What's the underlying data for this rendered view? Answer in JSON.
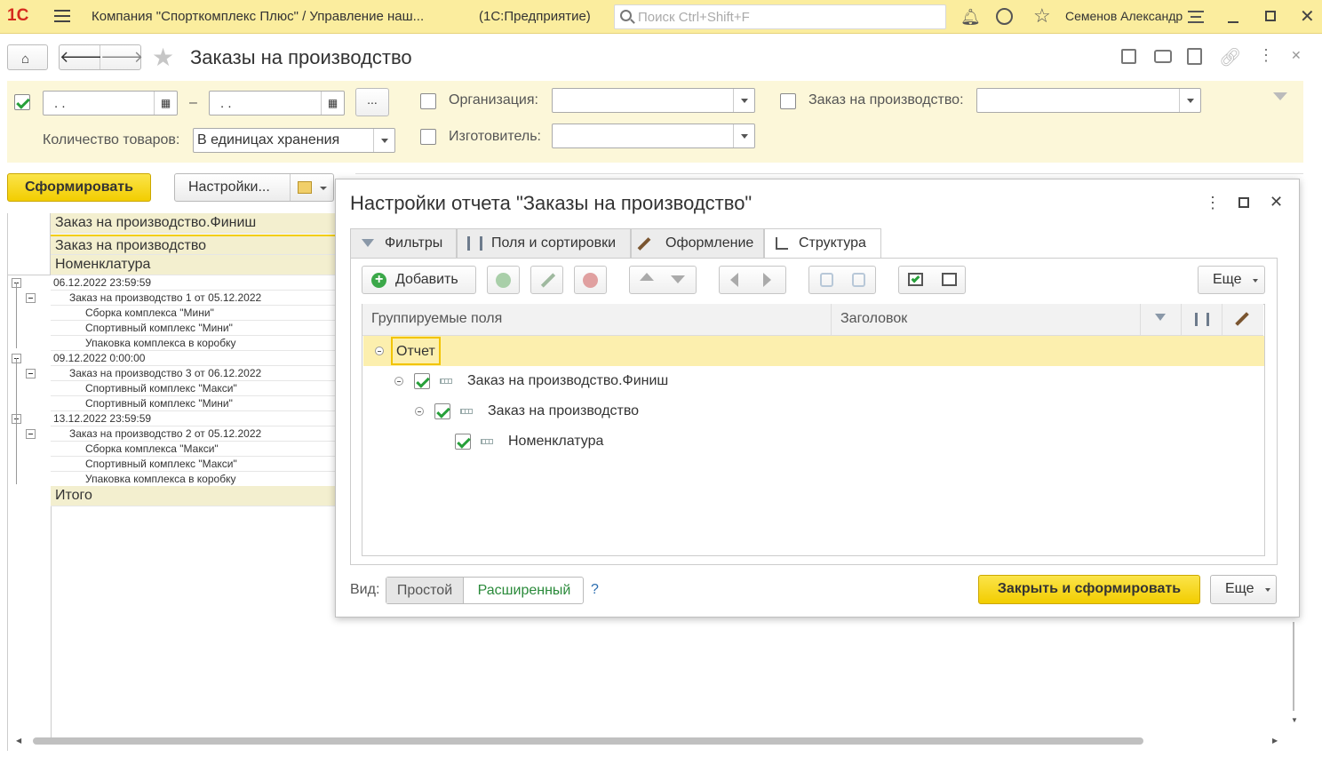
{
  "app": {
    "logo": "1С",
    "title": "Компания \"Спорткомплекс Плюс\" / Управление наш...",
    "platform": "(1С:Предприятие)",
    "search_placeholder": "Поиск Ctrl+Shift+F",
    "user": "Семенов Александр"
  },
  "page": {
    "title": "Заказы на производство"
  },
  "filters": {
    "date_from": " .  .",
    "date_to": " .  .",
    "dash": "–",
    "more": "...",
    "org_label": "Организация:",
    "order_label": "Заказ на производство:",
    "qty_label": "Количество товаров:",
    "qty_value": "В единицах хранения",
    "maker_label": "Изготовитель:"
  },
  "toolbar": {
    "generate": "Сформировать",
    "settings": "Настройки..."
  },
  "report": {
    "headers": [
      "Заказ на производство.Финиш",
      "Заказ на производство",
      "Номенклатура"
    ],
    "rows": [
      {
        "level": 0,
        "text": "06.12.2022 23:59:59"
      },
      {
        "level": 1,
        "text": "Заказ на производство 1 от 05.12.2022"
      },
      {
        "level": 2,
        "text": "Сборка комплекса \"Мини\""
      },
      {
        "level": 2,
        "text": "Спортивный комплекс \"Мини\""
      },
      {
        "level": 2,
        "text": "Упаковка комплекса в коробку"
      },
      {
        "level": 0,
        "text": "09.12.2022 0:00:00"
      },
      {
        "level": 1,
        "text": "Заказ на производство 3 от 06.12.2022"
      },
      {
        "level": 2,
        "text": "Спортивный комплекс \"Макси\""
      },
      {
        "level": 2,
        "text": "Спортивный комплекс \"Мини\""
      },
      {
        "level": 0,
        "text": "13.12.2022 23:59:59"
      },
      {
        "level": 1,
        "text": "Заказ на производство 2 от 05.12.2022"
      },
      {
        "level": 2,
        "text": "Сборка комплекса \"Макси\""
      },
      {
        "level": 2,
        "text": "Спортивный комплекс \"Макси\""
      },
      {
        "level": 2,
        "text": "Упаковка комплекса в коробку"
      }
    ],
    "total": "Итого"
  },
  "dialog": {
    "title": "Настройки отчета \"Заказы на производство\"",
    "tabs": [
      "Фильтры",
      "Поля и сортировки",
      "Оформление",
      "Структура"
    ],
    "add": "Добавить",
    "more": "Еще",
    "col_grouped": "Группируемые поля",
    "col_caption": "Заголовок",
    "tree": {
      "root": "Отчет",
      "level1": "Заказ на производство.Финиш",
      "level2": "Заказ на производство",
      "level3": "Номенклатура"
    },
    "view_label": "Вид:",
    "view_simple": "Простой",
    "view_extended": "Расширенный",
    "help": "?",
    "close_generate": "Закрыть и сформировать",
    "more_bottom": "Еще"
  },
  "colors": {
    "accent_yellow": "#f2cd00",
    "title_bar": "#fbed9e",
    "check_green": "#27a03a"
  }
}
